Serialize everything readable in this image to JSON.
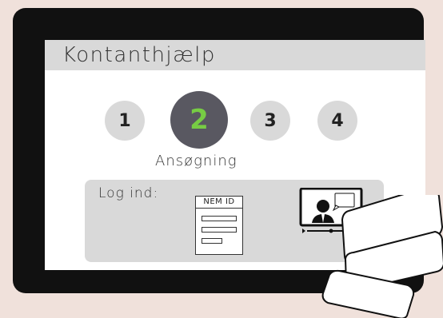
{
  "header": {
    "title": "Kontanthjælp"
  },
  "steps": [
    {
      "number": "1"
    },
    {
      "number": "2",
      "active": true
    },
    {
      "number": "3"
    },
    {
      "number": "4"
    }
  ],
  "current_step_label": "Ansøgning",
  "login": {
    "label": "Log ind:",
    "nemid_header": "NEM ID"
  },
  "colors": {
    "page_background": "#f0e1db",
    "device_frame": "#111111",
    "active_step_fill": "#595861",
    "active_step_number": "#77cc44",
    "inactive_step_fill": "#d9d9d9",
    "panel_fill": "#d9d9d9"
  }
}
